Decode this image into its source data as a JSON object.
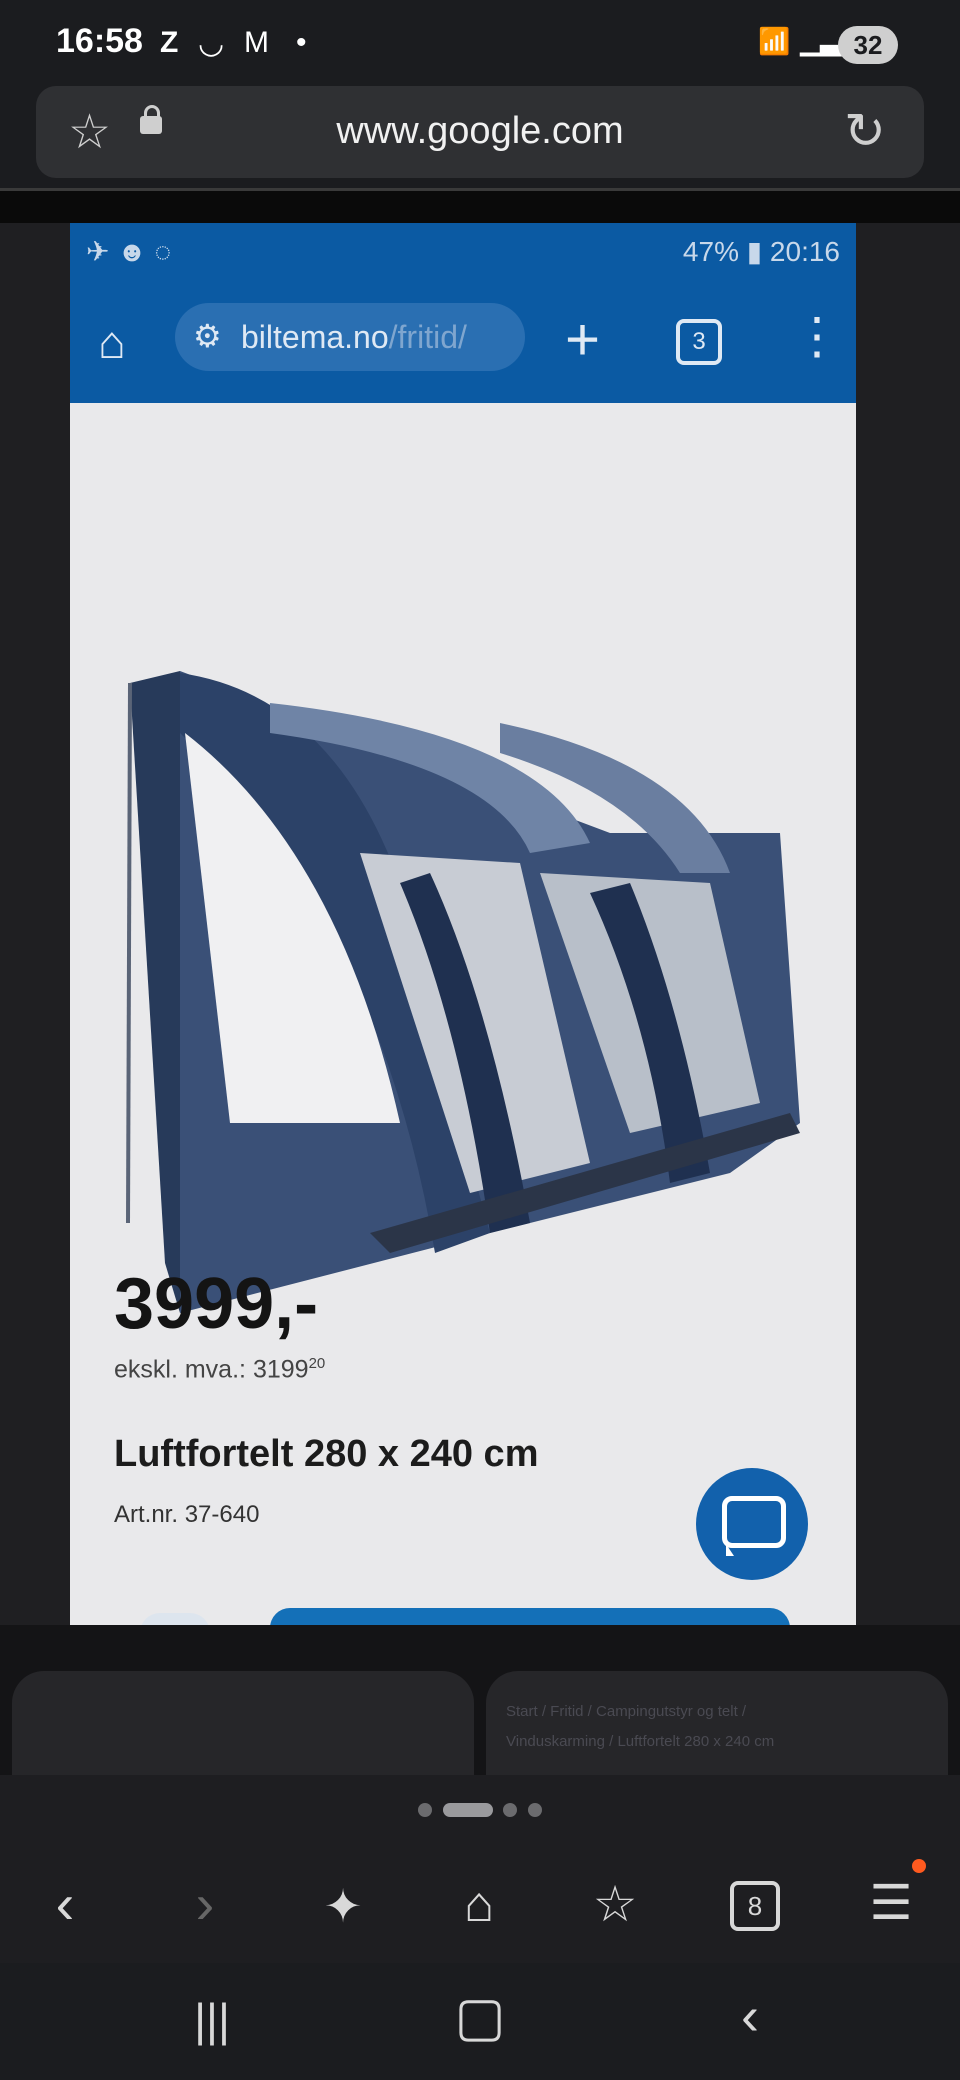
{
  "status_bar": {
    "time": "16:58",
    "left_icons": [
      "Z",
      "◡",
      "M",
      "•"
    ],
    "right_icons": "wifi-5-icon signal-icon",
    "battery": "32"
  },
  "browser": {
    "url": "www.google.com"
  },
  "screenshot": {
    "status_left": "✈ ☻ ◌",
    "status_right": "47% ▮ 20:16",
    "url_domain": "biltema.no",
    "url_path": "/fritid/",
    "tabs_count": "3",
    "price": "3999,-",
    "ex_vat_label": "ekskl. mva.:",
    "ex_vat_value": "3199",
    "ex_vat_cents": "20",
    "product_name": "Luftfortelt 280 x 240 cm",
    "art_nr": "Art.nr. 37-640"
  },
  "right_card": {
    "breadcrumb_line1": "Start /  Fritid /  Campingutstyr og telt /",
    "breadcrumb_line2": "Vinduskarming /  Luftfortelt 280 x 240 cm"
  },
  "pager": {
    "count": 4,
    "active_index": 1
  },
  "bottom_nav": {
    "tabs_count": "8"
  },
  "colors": {
    "biltema_blue": "#0b5aa3",
    "chat_blue": "#1261ac",
    "notification_dot": "#ff5a1f"
  }
}
